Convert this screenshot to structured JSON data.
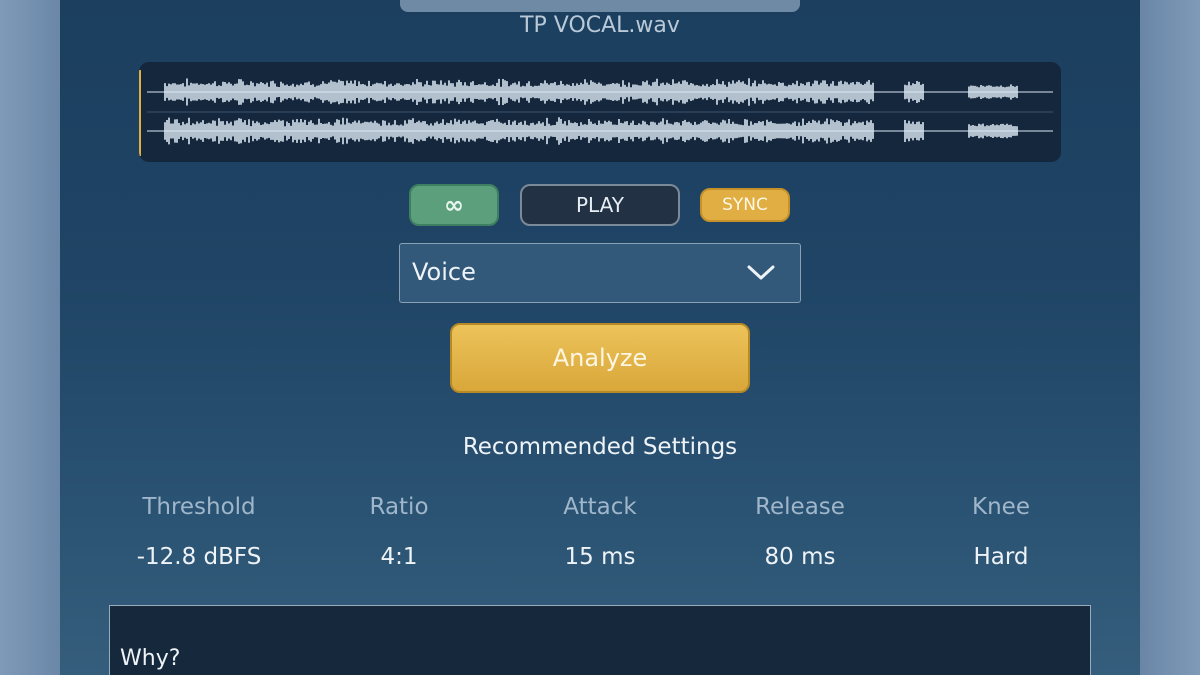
{
  "file": {
    "name": "TP VOCAL.wav"
  },
  "transport": {
    "loop_label": "∞",
    "play_label": "PLAY",
    "sync_label": "SYNC"
  },
  "preset": {
    "selected": "Voice"
  },
  "analyze": {
    "label": "Analyze"
  },
  "recommended": {
    "title": "Recommended Settings",
    "settings": [
      {
        "label": "Threshold",
        "value": "-12.8 dBFS"
      },
      {
        "label": "Ratio",
        "value": "4:1"
      },
      {
        "label": "Attack",
        "value": "15 ms"
      },
      {
        "label": "Release",
        "value": "80 ms"
      },
      {
        "label": "Knee",
        "value": "Hard"
      }
    ]
  },
  "why": {
    "label": "Why?"
  },
  "colors": {
    "panel": "#1f4465",
    "loop_button": "#5b9f7d",
    "play_button": "#223244",
    "sync_button": "#e0ae43",
    "analyze_button": "#e2b24a",
    "waveform": "#dbe8f4",
    "playhead": "#e0ae43"
  },
  "icons": {
    "loop": "infinity-icon",
    "dropdown": "chevron-down-icon"
  }
}
